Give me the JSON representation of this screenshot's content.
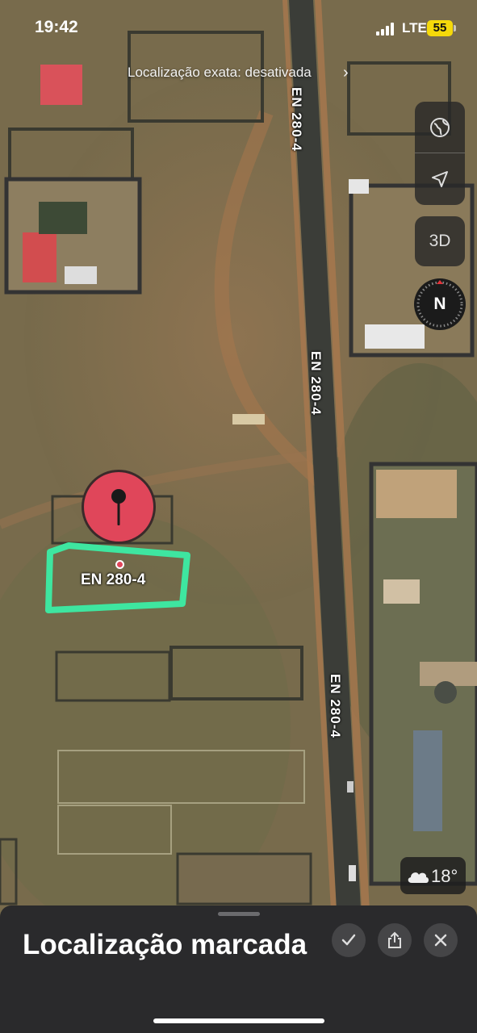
{
  "status_bar": {
    "time": "19:42",
    "network": "LTE",
    "battery": "55"
  },
  "banner": {
    "text": "Localização exata: desativada"
  },
  "map": {
    "style": "satellite",
    "road_labels": [
      "EN 280-4",
      "EN 280-4",
      "EN 280-4"
    ],
    "pin_label": "EN 280-4",
    "pin_color": "#e0465a",
    "highlight_color": "#3ee6a0"
  },
  "controls": {
    "globe_icon": "globe-icon",
    "location_icon": "location-arrow-icon",
    "view_3d_label": "3D",
    "compass_label": "N"
  },
  "weather": {
    "icon": "cloud-icon",
    "temperature": "18°"
  },
  "sheet": {
    "title": "Localização marcada",
    "actions": [
      "checkmark-icon",
      "share-icon",
      "close-icon"
    ]
  }
}
